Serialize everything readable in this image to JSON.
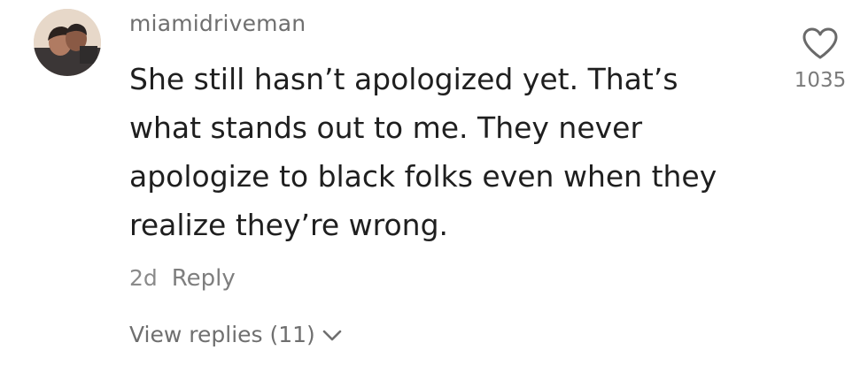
{
  "comment": {
    "username": "miamidriveman",
    "text_lines": [
      "She still hasn’t apologized yet. That’s",
      "what stands out to me. They never",
      "apologize to black folks even when they",
      "realize they’re wrong."
    ],
    "time_ago": "2d",
    "reply_label": "Reply",
    "view_replies_label": "View replies (11)",
    "like_count": "1035"
  },
  "icons": {
    "like": "heart-outline-icon",
    "expand": "chevron-down-icon"
  },
  "colors": {
    "username": "#6f6f6f",
    "text": "#1f1f1f",
    "secondary": "#8a8a8a"
  }
}
